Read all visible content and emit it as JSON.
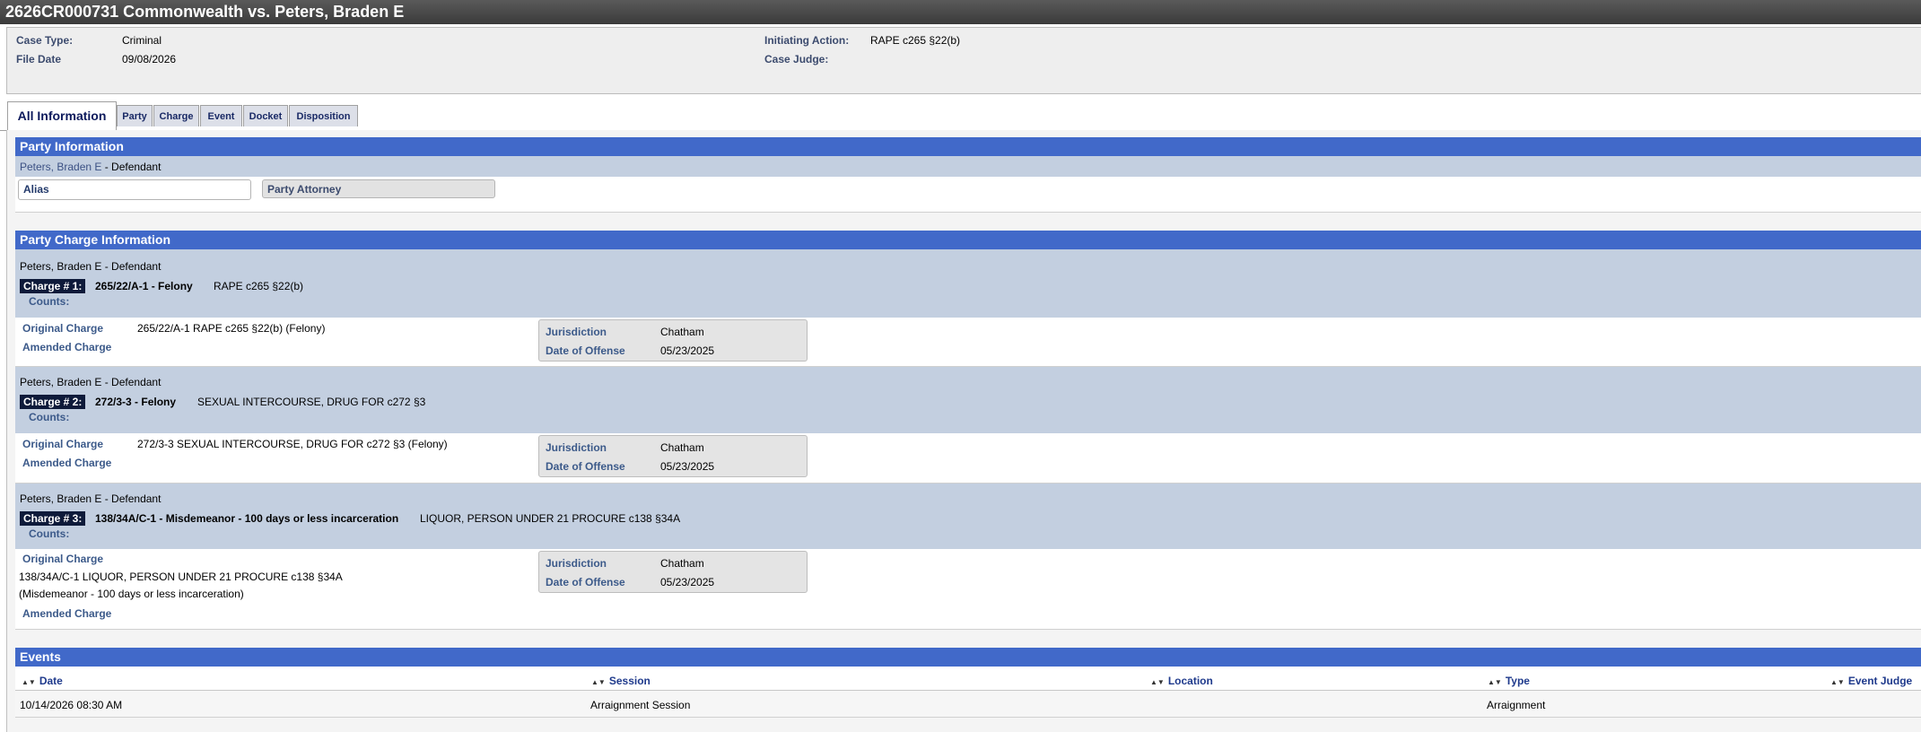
{
  "case_title": "2626CR000731 Commonwealth vs. Peters, Braden E",
  "header": {
    "case_type_label": "Case Type:",
    "case_type": "Criminal",
    "file_date_label": "File Date",
    "file_date": "09/08/2026",
    "initiating_action_label": "Initiating Action:",
    "initiating_action": "RAPE c265 §22(b)",
    "case_judge_label": "Case Judge:",
    "case_judge": ""
  },
  "tabs": [
    "All Information",
    "Party",
    "Charge",
    "Event",
    "Docket",
    "Disposition"
  ],
  "party_info": {
    "title": "Party Information",
    "party_name": "Peters, Braden E",
    "party_role": " - Defendant",
    "alias_label": "Alias",
    "attorney_label": "Party Attorney"
  },
  "charge_info": {
    "title": "Party Charge Information",
    "original_label": "Original Charge",
    "amended_label": "Amended Charge",
    "counts_label": "Counts:",
    "jurisdiction_label": "Jurisdiction",
    "offense_date_label": "Date of Offense",
    "charges": [
      {
        "party": "Peters, Braden E - Defendant",
        "badge": "Charge # 1:",
        "code": "265/22/A-1 - Felony",
        "desc": "RAPE c265 §22(b)",
        "original": "265/22/A-1 RAPE c265 §22(b) (Felony)",
        "jurisdiction": "Chatham",
        "offense_date": "05/23/2025"
      },
      {
        "party": "Peters, Braden E - Defendant",
        "badge": "Charge # 2:",
        "code": "272/3-3 - Felony",
        "desc": "SEXUAL INTERCOURSE, DRUG FOR c272 §3",
        "original": "272/3-3 SEXUAL INTERCOURSE, DRUG FOR c272 §3 (Felony)",
        "jurisdiction": "Chatham",
        "offense_date": "05/23/2025"
      },
      {
        "party": "Peters, Braden E - Defendant",
        "badge": "Charge # 3:",
        "code": "138/34A/C-1 - Misdemeanor - 100 days or less incarceration",
        "desc": "LIQUOR, PERSON UNDER 21 PROCURE c138 §34A",
        "original_line1": "138/34A/C-1 LIQUOR, PERSON UNDER 21 PROCURE c138 §34A",
        "original_line2": "(Misdemeanor - 100 days or less incarceration)",
        "jurisdiction": "Chatham",
        "offense_date": "05/23/2025"
      }
    ]
  },
  "events": {
    "title": "Events",
    "columns": [
      "Date",
      "Session",
      "Location",
      "Type",
      "Event Judge"
    ],
    "rows": [
      [
        "10/14/2026 08:30 AM",
        "Arraignment Session",
        "",
        "Arraignment",
        ""
      ]
    ]
  },
  "colors": {
    "section_header": "#4169c9",
    "band": "#c3cfe0",
    "badge": "#0e1a3a"
  },
  "icons": {
    "sort": "sort-arrows-icon"
  }
}
